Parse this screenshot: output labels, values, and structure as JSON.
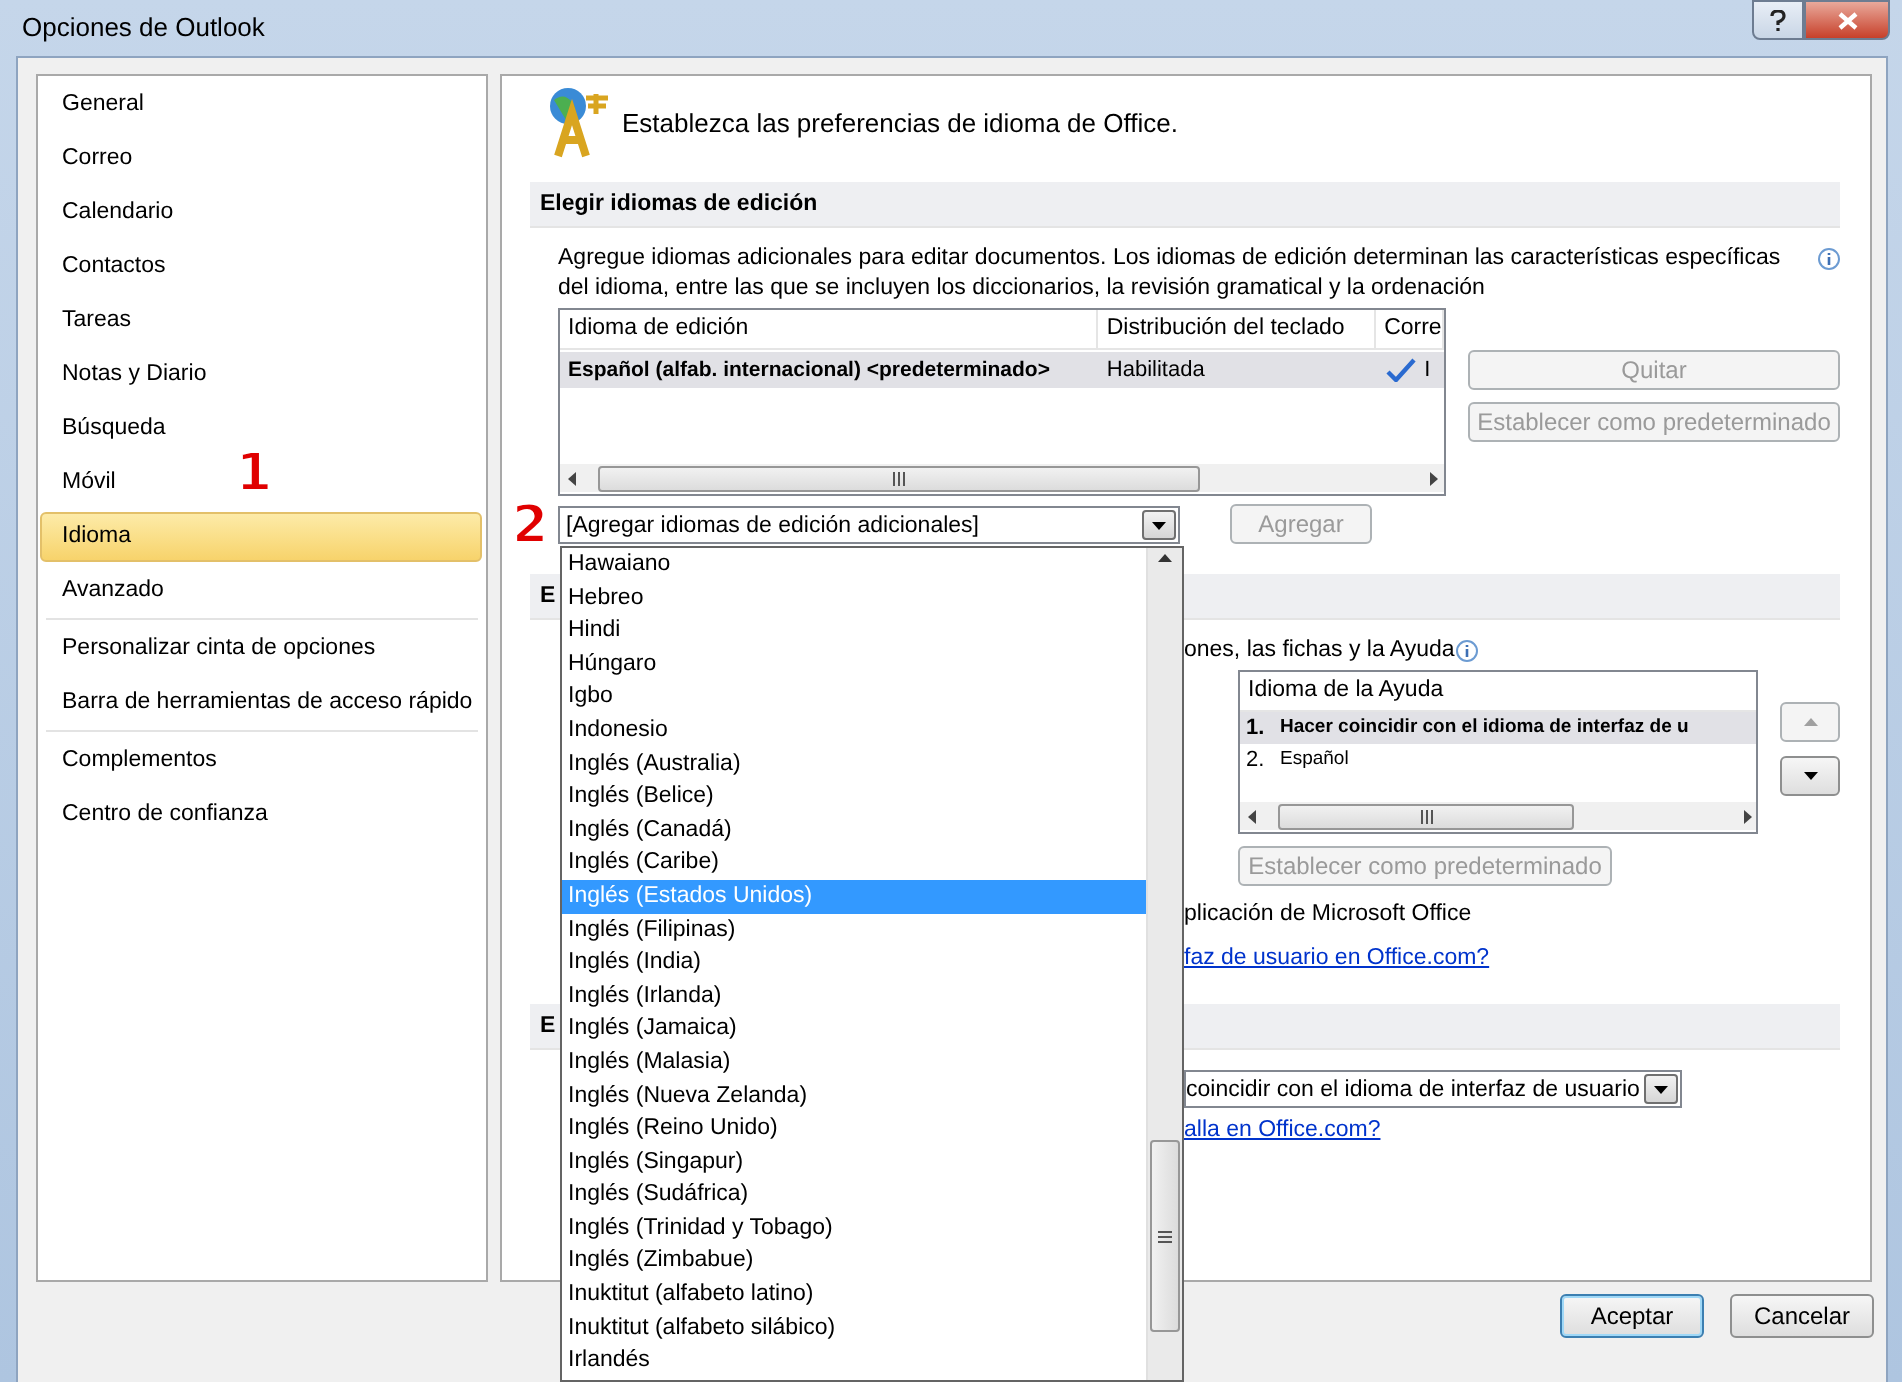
{
  "window": {
    "title": "Opciones de Outlook"
  },
  "sidebar": {
    "groups": [
      {
        "items": [
          {
            "label": "General",
            "selected": false
          },
          {
            "label": "Correo",
            "selected": false
          },
          {
            "label": "Calendario",
            "selected": false
          },
          {
            "label": "Contactos",
            "selected": false
          },
          {
            "label": "Tareas",
            "selected": false
          },
          {
            "label": "Notas y Diario",
            "selected": false
          },
          {
            "label": "Búsqueda",
            "selected": false
          },
          {
            "label": "Móvil",
            "selected": false
          },
          {
            "label": "Idioma",
            "selected": true
          },
          {
            "label": "Avanzado",
            "selected": false
          }
        ]
      },
      {
        "items": [
          {
            "label": "Personalizar cinta de opciones",
            "selected": false
          },
          {
            "label": "Barra de herramientas de acceso rápido",
            "selected": false
          }
        ]
      },
      {
        "items": [
          {
            "label": "Complementos",
            "selected": false
          },
          {
            "label": "Centro de confianza",
            "selected": false
          }
        ]
      }
    ]
  },
  "annotations": [
    {
      "text": "1"
    },
    {
      "text": "2"
    }
  ],
  "header": {
    "title": "Establezca las preferencias de idioma de Office."
  },
  "editing_section": {
    "title": "Elegir idiomas de edición",
    "description": "Agregue idiomas adicionales para editar documentos. Los idiomas de edición determinan las características específicas del idioma, entre las que se incluyen los diccionarios, la revisión gramatical y la ordenación",
    "table": {
      "columns": [
        "Idioma de edición",
        "Distribución del teclado",
        "Corre"
      ],
      "rows": [
        {
          "cells": [
            "Español (alfab. internacional) <predeterminado>",
            "Habilitada",
            "I"
          ],
          "selected": true
        }
      ]
    },
    "buttons": [
      {
        "label": "Quitar",
        "disabled": true
      },
      {
        "label": "Establecer como predeterminado",
        "disabled": true
      }
    ],
    "combo": {
      "value": "[Agregar idiomas de edición adicionales]"
    },
    "add_button": {
      "label": "Agregar",
      "disabled": true
    }
  },
  "dropdown": {
    "items": [
      {
        "label": "Hawaiano",
        "selected": false
      },
      {
        "label": "Hebreo",
        "selected": false
      },
      {
        "label": "Hindi",
        "selected": false
      },
      {
        "label": "Húngaro",
        "selected": false
      },
      {
        "label": "Igbo",
        "selected": false
      },
      {
        "label": "Indonesio",
        "selected": false
      },
      {
        "label": "Inglés (Australia)",
        "selected": false
      },
      {
        "label": "Inglés (Belice)",
        "selected": false
      },
      {
        "label": "Inglés (Canadá)",
        "selected": false
      },
      {
        "label": "Inglés (Caribe)",
        "selected": false
      },
      {
        "label": "Inglés (Estados Unidos)",
        "selected": true
      },
      {
        "label": "Inglés (Filipinas)",
        "selected": false
      },
      {
        "label": "Inglés (India)",
        "selected": false
      },
      {
        "label": "Inglés (Irlanda)",
        "selected": false
      },
      {
        "label": "Inglés (Jamaica)",
        "selected": false
      },
      {
        "label": "Inglés (Malasia)",
        "selected": false
      },
      {
        "label": "Inglés (Nueva Zelanda)",
        "selected": false
      },
      {
        "label": "Inglés (Reino Unido)",
        "selected": false
      },
      {
        "label": "Inglés (Singapur)",
        "selected": false
      },
      {
        "label": "Inglés (Sudáfrica)",
        "selected": false
      },
      {
        "label": "Inglés (Trinidad y Tobago)",
        "selected": false
      },
      {
        "label": "Inglés (Zimbabue)",
        "selected": false
      },
      {
        "label": "Inuktitut (alfabeto latino)",
        "selected": false
      },
      {
        "label": "Inuktitut (alfabeto silábico)",
        "selected": false
      },
      {
        "label": "Irlandés",
        "selected": false
      }
    ]
  },
  "display_section": {
    "title": "E",
    "text": "ones, las fichas y la Ayuda",
    "help_list": {
      "column": "Idioma de la Ayuda",
      "rows": [
        {
          "number": "1.",
          "label": "Hacer coincidir con el idioma de interfaz de u",
          "selected": true
        },
        {
          "number": "2.",
          "label": "Español",
          "selected": false
        }
      ]
    },
    "move_buttons": [
      {
        "kind": "up",
        "disabled": true
      },
      {
        "kind": "down",
        "disabled": false
      }
    ],
    "set_default_button": {
      "label": "Establecer como predeterminado",
      "disabled": true
    },
    "note": "plicación de Microsoft Office",
    "link": "faz de usuario en Office.com?"
  },
  "tooltip_section": {
    "title": "E",
    "select": {
      "value": "coincidir con el idioma de interfaz de usuario"
    },
    "link": "alla en Office.com?"
  },
  "footer": {
    "buttons": [
      {
        "label": "Aceptar",
        "default": true
      },
      {
        "label": "Cancelar",
        "default": false
      }
    ]
  }
}
